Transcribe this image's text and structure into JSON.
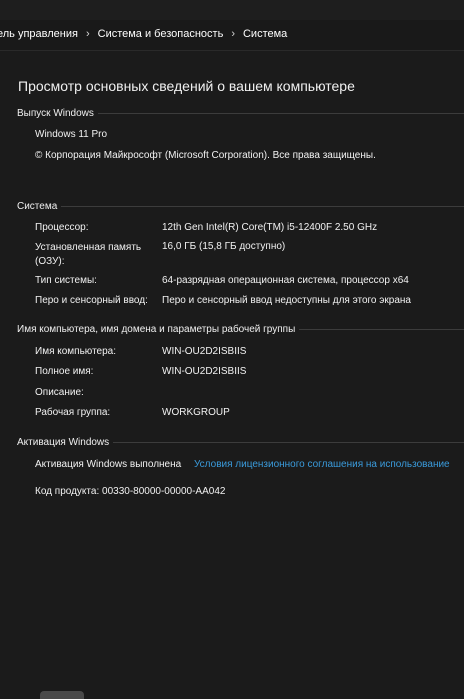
{
  "breadcrumb": {
    "items": [
      "ель управления",
      "Система и безопасность",
      "Система"
    ],
    "separator": "›"
  },
  "page": {
    "title": "Просмотр основных сведений о вашем компьютере"
  },
  "windows_edition": {
    "header": "Выпуск Windows",
    "edition": "Windows 11 Pro",
    "copyright": "© Корпорация Майкрософт (Microsoft Corporation). Все права защищены."
  },
  "system": {
    "header": "Система",
    "rows": [
      {
        "label": "Процессор:",
        "value": "12th Gen Intel(R) Core(TM) i5-12400F   2.50 GHz"
      },
      {
        "label": "Установленная память\n(ОЗУ):",
        "value": "16,0 ГБ (15,8 ГБ доступно)"
      },
      {
        "label": "Тип системы:",
        "value": "64-разрядная операционная система, процессор x64"
      },
      {
        "label": "Перо и сенсорный ввод:",
        "value": "Перо и сенсорный ввод недоступны для этого экрана"
      }
    ]
  },
  "computer_name": {
    "header": "Имя компьютера, имя домена и параметры рабочей группы",
    "rows": [
      {
        "label": "Имя компьютера:",
        "value": "WIN-OU2D2ISBIIS"
      },
      {
        "label": "Полное имя:",
        "value": "WIN-OU2D2ISBIIS"
      },
      {
        "label": "Описание:",
        "value": ""
      },
      {
        "label": "Рабочая группа:",
        "value": "WORKGROUP"
      }
    ]
  },
  "activation": {
    "header": "Активация Windows",
    "status": "Активация Windows выполнена",
    "license_link": "Условия лицензионного соглашения на использование",
    "product_key": "Код продукта: 00330-80000-00000-AA042"
  },
  "colors": {
    "background": "#1b1b1b",
    "link": "#3a9bdc",
    "text": "#f2f2f2"
  }
}
